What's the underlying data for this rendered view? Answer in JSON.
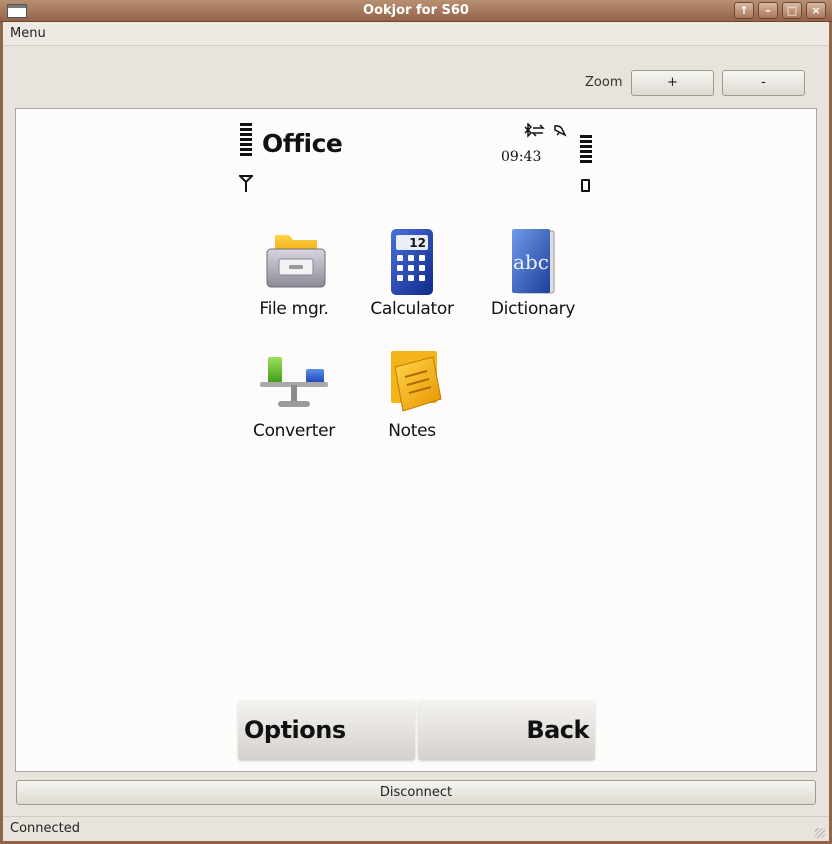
{
  "window": {
    "title": "Ookjor for S60"
  },
  "menubar": {
    "menu_label": "Menu"
  },
  "zoom": {
    "label": "Zoom",
    "plus_label": "+",
    "minus_label": "-"
  },
  "phone": {
    "title": "Office",
    "clock": "09:43",
    "apps": [
      {
        "label": "File mgr.",
        "icon": "file-manager-icon"
      },
      {
        "label": "Calculator",
        "icon": "calculator-icon"
      },
      {
        "label": "Dictionary",
        "icon": "dictionary-icon"
      },
      {
        "label": "Converter",
        "icon": "converter-icon"
      },
      {
        "label": "Notes",
        "icon": "notes-icon"
      }
    ],
    "calculator_display": "12",
    "dictionary_letters": "abc",
    "softkeys": {
      "left": "Options",
      "right": "Back"
    }
  },
  "controls": {
    "disconnect_label": "Disconnect"
  },
  "status": {
    "text": "Connected"
  },
  "colors": {
    "titlebar": "#93634a",
    "window_bg": "#e8e4dc",
    "screen_bg": "#fdfcfb"
  }
}
